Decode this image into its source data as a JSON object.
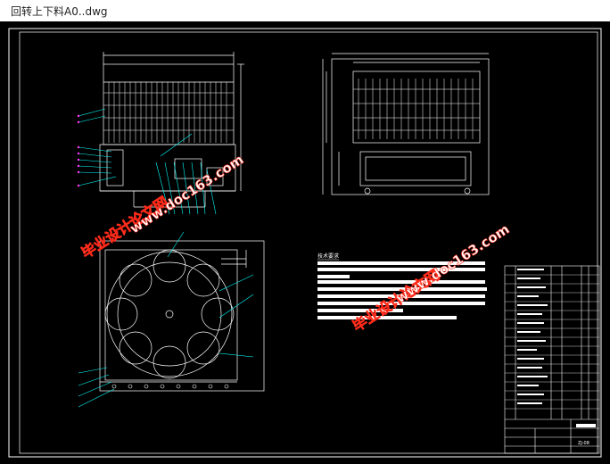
{
  "window": {
    "title": "回转上下料A0..dwg"
  },
  "drawing": {
    "notes_heading": "技术要求",
    "watermark_cn": "毕业设计论文网",
    "watermark_url": "www.doc163.com",
    "title_block_code": "ZJ-08"
  },
  "colors": {
    "background": "#000000",
    "lines": "#ffffff",
    "leaders": "#00ffff",
    "watermark_fill": "#ffffff",
    "watermark_stroke": "#ff2a1a"
  }
}
